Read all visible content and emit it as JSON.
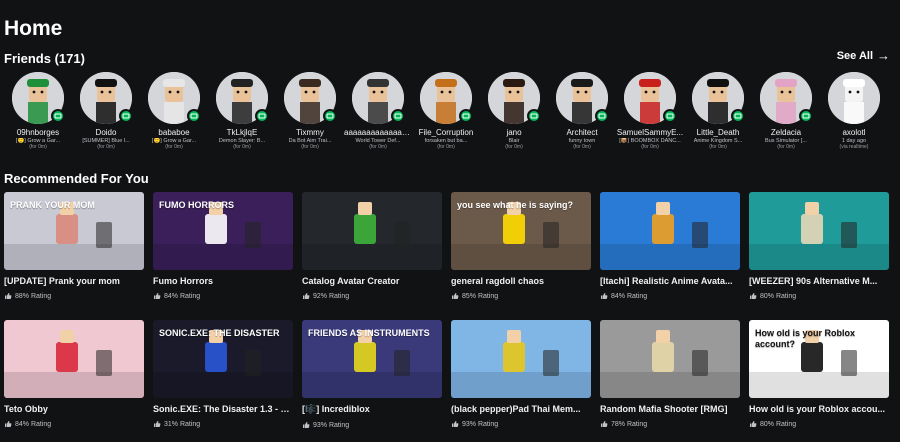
{
  "page": {
    "title": "Home"
  },
  "friends": {
    "title": "Friends (171)",
    "see_all": "See All",
    "items": [
      {
        "name": "09hnborges",
        "game": "[🙂] Grow a Gar...",
        "sub": "(for 0m)",
        "color": "#1f8f3a"
      },
      {
        "name": "Doido",
        "game": "[SUMMER] Blue l...",
        "sub": "(for 0m)",
        "color": "#111111"
      },
      {
        "name": "bababoe",
        "game": "[🙂] Grow a Gar...",
        "sub": "(for 0m)",
        "color": "#e7e7e7"
      },
      {
        "name": "TkLkjlqE",
        "game": "Demon Slayer: B...",
        "sub": "(for 0m)",
        "color": "#222222"
      },
      {
        "name": "Tixmmy",
        "game": "Da Bot Aim Trai...",
        "sub": "(for 0m)",
        "color": "#3a2a20"
      },
      {
        "name": "aaaaaaaaaaaaaa...",
        "game": "World Tower Def...",
        "sub": "(for 0m)",
        "color": "#333333"
      },
      {
        "name": "File_Corruption",
        "game": "forsaken but ba...",
        "sub": "(for 0m)",
        "color": "#c4701a"
      },
      {
        "name": "jano",
        "game": "Blair",
        "sub": "(for 0m)",
        "color": "#2a1a12"
      },
      {
        "name": "Architect",
        "game": "funny town",
        "sub": "(for 0m)",
        "color": "#1a1a1a"
      },
      {
        "name": "SamuelSammyE...",
        "game": "[📦] BOOMBOX DANC...",
        "sub": "(for 0m)",
        "color": "#c8201c"
      },
      {
        "name": "Little_Death",
        "game": "Anime Kingdom S...",
        "sub": "(for 0m)",
        "color": "#101010"
      },
      {
        "name": "Zeldacia",
        "game": "Bus Simulator [...",
        "sub": "(for 0m)",
        "color": "#e3a3c4"
      },
      {
        "name": "axolotl",
        "game": "1 day ago",
        "sub": "(via realtime)",
        "color": "#ffffff",
        "offline": true
      }
    ]
  },
  "recommended": {
    "title": "Recommended For You",
    "rows": [
      [
        {
          "title": "[UPDATE] Prank your mom",
          "rating": "88% Rating",
          "bg": "#c9c9d4",
          "accent": "#d88a7a",
          "label": "PRANK YOUR MOM"
        },
        {
          "title": "Fumo Horrors",
          "rating": "84% Rating",
          "bg": "#3a1f5a",
          "accent": "#ffffff",
          "label": "FUMO HORRORS"
        },
        {
          "title": "Catalog Avatar Creator",
          "rating": "92% Rating",
          "bg": "#24272c",
          "accent": "#3fb43c",
          "label": ""
        },
        {
          "title": "general ragdoll chaos",
          "rating": "85% Rating",
          "bg": "#6b5a4a",
          "accent": "#ffdb00",
          "label": "you see what he is saying?"
        },
        {
          "title": "[Itachi] Realistic Anime Avata...",
          "rating": "84% Rating",
          "bg": "#2a7bd6",
          "accent": "#f0a020",
          "label": ""
        },
        {
          "title": "[WEEZER] 90s Alternative M...",
          "rating": "80% Rating",
          "bg": "#1f9c9a",
          "accent": "#e8d8b8",
          "label": ""
        }
      ],
      [
        {
          "title": "Teto Obby",
          "rating": "84% Rating",
          "bg": "#f0c8d2",
          "accent": "#d8283a",
          "label": ""
        },
        {
          "title": "Sonic.EXE: The Disaster 1.3 - R...",
          "rating": "31% Rating",
          "bg": "#1a1a2a",
          "accent": "#2a56d8",
          "label": "SONIC.EXE: THE DISASTER"
        },
        {
          "title": "[🎼] Incrediblox",
          "rating": "93% Rating",
          "bg": "#3a3a7a",
          "accent": "#e8d818",
          "label": "FRIENDS AS INSTRUMENTS"
        },
        {
          "title": "(black pepper)Pad Thai Mem...",
          "rating": "93% Rating",
          "bg": "#7fb6e6",
          "accent": "#e8c818",
          "label": ""
        },
        {
          "title": "Random Mafia Shooter [RMG]",
          "rating": "78% Rating",
          "bg": "#9a9a9a",
          "accent": "#e8d8a8",
          "label": ""
        },
        {
          "title": "How old is your Roblox accou...",
          "rating": "80% Rating",
          "bg": "#ffffff",
          "accent": "#111111",
          "label": "How old is your Roblox account?"
        }
      ]
    ]
  }
}
